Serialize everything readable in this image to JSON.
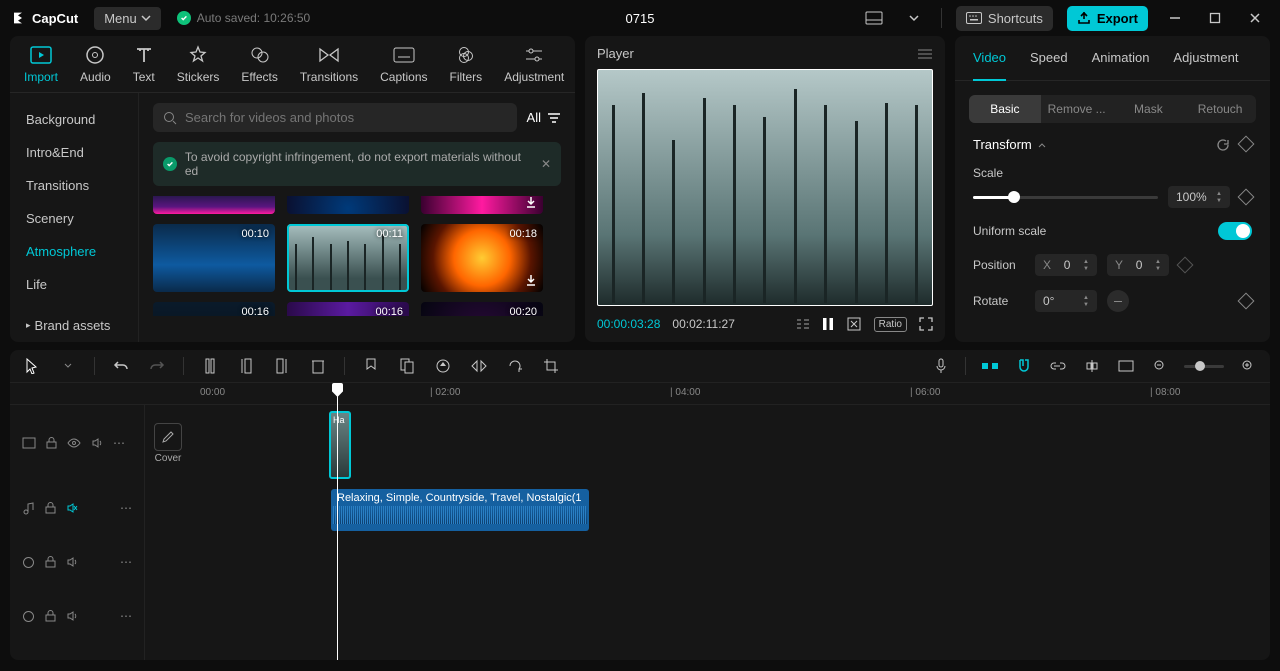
{
  "titlebar": {
    "app": "CapCut",
    "menu": "Menu",
    "autosave": "Auto saved: 10:26:50",
    "project": "0715",
    "shortcuts": "Shortcuts",
    "export": "Export"
  },
  "topTabs": [
    "Import",
    "Audio",
    "Text",
    "Stickers",
    "Effects",
    "Transitions",
    "Captions",
    "Filters",
    "Adjustment"
  ],
  "topTabActive": "Import",
  "sidebar": {
    "items": [
      "Background",
      "Intro&End",
      "Transitions",
      "Scenery",
      "Atmosphere",
      "Life"
    ],
    "active": "Atmosphere",
    "brand": "Brand assets"
  },
  "search": {
    "placeholder": "Search for videos and photos",
    "filter": "All"
  },
  "notice": "To avoid copyright infringement, do not export materials without ed",
  "thumbs": {
    "row1": [
      {
        "dur": "",
        "dl": false
      },
      {
        "dur": "",
        "dl": false
      },
      {
        "dur": "",
        "dl": true
      }
    ],
    "row2": [
      {
        "dur": "00:10",
        "dl": false
      },
      {
        "dur": "00:11",
        "dl": false,
        "sel": true
      },
      {
        "dur": "00:18",
        "dl": true
      }
    ],
    "row3": [
      {
        "dur": "00:16"
      },
      {
        "dur": "00:16"
      },
      {
        "dur": "00:20"
      }
    ]
  },
  "player": {
    "title": "Player",
    "current": "00:00:03:28",
    "duration": "00:02:11:27",
    "ratio": "Ratio"
  },
  "right": {
    "tabs": [
      "Video",
      "Speed",
      "Animation",
      "Adjustment"
    ],
    "tabActive": "Video",
    "subtabs": [
      "Basic",
      "Remove ...",
      "Mask",
      "Retouch"
    ],
    "subActive": "Basic",
    "transform": "Transform",
    "scale": {
      "label": "Scale",
      "value": "100%"
    },
    "uniform": "Uniform scale",
    "position": {
      "label": "Position",
      "xl": "X",
      "x": "0",
      "yl": "Y",
      "y": "0"
    },
    "rotate": {
      "label": "Rotate",
      "value": "0°"
    }
  },
  "ruler": [
    "00:00",
    "| 02:00",
    "| 04:00",
    "| 06:00",
    "| 08:00"
  ],
  "cover": "Cover",
  "clips": {
    "videoLabel": "Ha",
    "audio": "Relaxing, Simple, Countryside, Travel, Nostalgic(1"
  }
}
